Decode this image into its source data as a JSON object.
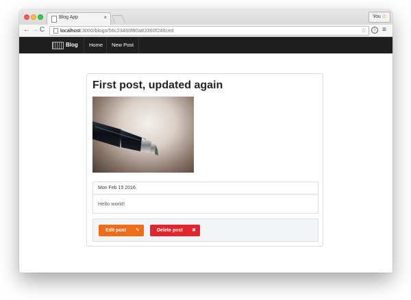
{
  "browser": {
    "tab_title": "Blog App",
    "tab_close": "×",
    "profile_label": "You",
    "profile_badge": "⚠",
    "url_host": "localhost",
    "url_path": ":3000/blogs/56c23460f80a83360f248ced",
    "back_glyph": "←",
    "forward_glyph": "→",
    "reload_glyph": "C",
    "star_glyph": "☆",
    "info_glyph": "i",
    "menu_glyph": "≡"
  },
  "navbar": {
    "brand": "Blog",
    "links": [
      "Home",
      "New Post"
    ],
    "background": "#1f1f1f"
  },
  "post": {
    "title": "First post, updated again",
    "image_alt": "pen",
    "date": "Mon Feb 15 2016",
    "body": "Hello world!"
  },
  "actions": {
    "edit_label": "Edit post",
    "edit_icon": "✎",
    "edit_color": "#ef6c1a",
    "delete_label": "Delete post",
    "delete_icon": "✖",
    "delete_color": "#e0252e"
  }
}
